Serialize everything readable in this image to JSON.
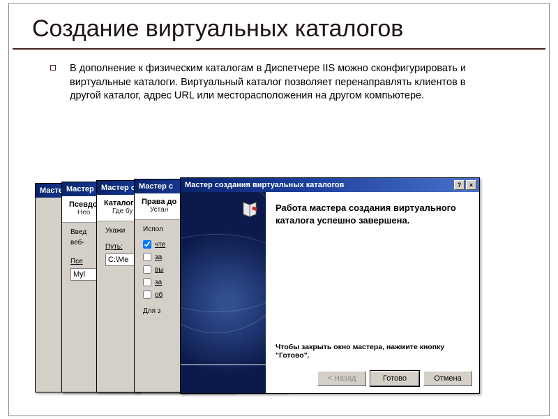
{
  "slide": {
    "title": "Создание виртуальных каталогов",
    "body": "В дополнение к физическим каталогам в Диспетчере IIS можно сконфигурировать и виртуальные каталоги. Виртуальный каталог позволяет перенаправлять клиентов в другой каталог, адрес URL или месторасположения на другом компьютере."
  },
  "wizard": {
    "title_short": "Мастер с",
    "title_full": "Мастер создания виртуальных каталогов",
    "steps": {
      "alias": {
        "header": "Псевдони",
        "sub": "Нео",
        "prompt": "Введ",
        "prompt2": "веб-",
        "label": "Псе",
        "value": "Myl"
      },
      "path": {
        "header": "Каталог",
        "sub": "Где бу",
        "prompt": "Укажи",
        "label": "Путь:",
        "value": "C:\\Me"
      },
      "permissions": {
        "header": "Права до",
        "sub": "Устан",
        "prompt": "Испол",
        "opts": [
          "чте",
          "за",
          "вы",
          "за",
          "об"
        ],
        "checked": [
          true,
          false,
          false,
          false,
          false
        ],
        "hint": "Для з"
      },
      "done": {
        "message": "Работа мастера создания виртуального каталога успешно завершена.",
        "closing": "Чтобы закрыть окно мастера, нажмите кнопку \"Готово\"."
      }
    },
    "buttons": {
      "back": "< Назад",
      "finish": "Готово",
      "cancel": "Отмена"
    }
  }
}
